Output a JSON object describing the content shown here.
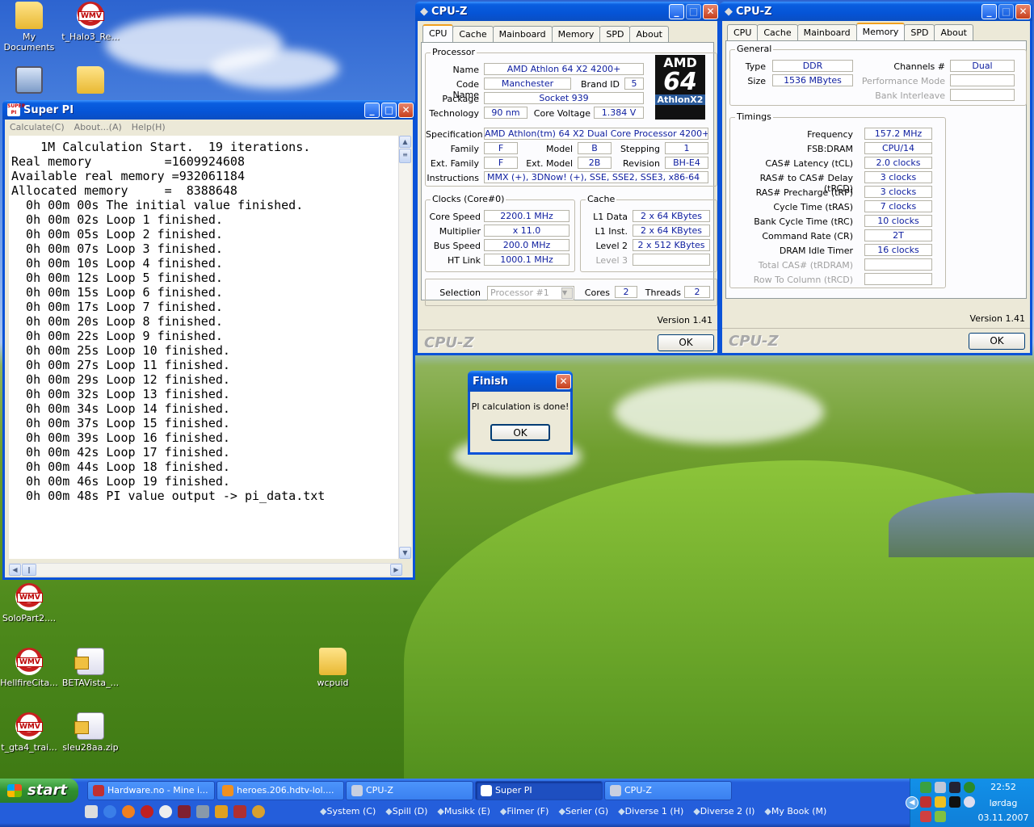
{
  "desktop": {
    "icons": [
      {
        "label": "My Documents",
        "type": "folder"
      },
      {
        "label": "t_Halo3_Re...",
        "type": "wmv"
      },
      {
        "label": "",
        "type": "pc"
      },
      {
        "label": "",
        "type": "folder"
      },
      {
        "label": "SoloPart2....",
        "type": "wmv"
      },
      {
        "label": "HellfireCita...",
        "type": "wmv"
      },
      {
        "label": "BETAVista_...",
        "type": "zip"
      },
      {
        "label": "wcpuid",
        "type": "folder"
      },
      {
        "label": "t_gta4_trai...",
        "type": "wmv"
      },
      {
        "label": "sleu28aa.zip",
        "type": "zip"
      }
    ]
  },
  "superpi": {
    "title": "Super PI",
    "menu": [
      "Calculate(C)",
      "About...(A)",
      "Help(H)"
    ],
    "lines": [
      "    1M Calculation Start.  19 iterations.",
      "Real memory          =1609924608",
      "Available real memory =932061184",
      "Allocated memory     =  8388648",
      "  0h 00m 00s The initial value finished.",
      "  0h 00m 02s Loop 1 finished.",
      "  0h 00m 05s Loop 2 finished.",
      "  0h 00m 07s Loop 3 finished.",
      "  0h 00m 10s Loop 4 finished.",
      "  0h 00m 12s Loop 5 finished.",
      "  0h 00m 15s Loop 6 finished.",
      "  0h 00m 17s Loop 7 finished.",
      "  0h 00m 20s Loop 8 finished.",
      "  0h 00m 22s Loop 9 finished.",
      "  0h 00m 25s Loop 10 finished.",
      "  0h 00m 27s Loop 11 finished.",
      "  0h 00m 29s Loop 12 finished.",
      "  0h 00m 32s Loop 13 finished.",
      "  0h 00m 34s Loop 14 finished.",
      "  0h 00m 37s Loop 15 finished.",
      "  0h 00m 39s Loop 16 finished.",
      "  0h 00m 42s Loop 17 finished.",
      "  0h 00m 44s Loop 18 finished.",
      "  0h 00m 46s Loop 19 finished.",
      "  0h 00m 48s PI value output -> pi_data.txt"
    ]
  },
  "cpuz1": {
    "title": "CPU-Z",
    "tabs": [
      "CPU",
      "Cache",
      "Mainboard",
      "Memory",
      "SPD",
      "About"
    ],
    "processor_label": "Processor",
    "name_label": "Name",
    "name": "AMD Athlon 64 X2 4200+",
    "codename_label": "Code Name",
    "codename": "Manchester",
    "brandid_label": "Brand ID",
    "brandid": "5",
    "package_label": "Package",
    "package": "Socket 939",
    "tech_label": "Technology",
    "tech": "90 nm",
    "voltage_label": "Core Voltage",
    "voltage": "1.384 V",
    "spec_label": "Specification",
    "spec": "AMD Athlon(tm) 64 X2 Dual Core Processor 4200+",
    "family_label": "Family",
    "family": "F",
    "model_label": "Model",
    "model": "B",
    "stepping_label": "Stepping",
    "stepping": "1",
    "extfamily_label": "Ext. Family",
    "extfamily": "F",
    "extmodel_label": "Ext. Model",
    "extmodel": "2B",
    "revision_label": "Revision",
    "revision": "BH-E4",
    "instr_label": "Instructions",
    "instr": "MMX (+), 3DNow! (+), SSE, SSE2, SSE3, x86-64",
    "logo": {
      "amd": "AMD",
      "n": "64",
      "sub": "AthlonX2"
    },
    "clocks_label": "Clocks (Core#0)",
    "corespeed_label": "Core Speed",
    "corespeed": "2200.1 MHz",
    "multiplier_label": "Multiplier",
    "multiplier": "x 11.0",
    "busspeed_label": "Bus Speed",
    "busspeed": "200.0 MHz",
    "htlink_label": "HT Link",
    "htlink": "1000.1 MHz",
    "cache_label": "Cache",
    "l1d_label": "L1 Data",
    "l1d": "2 x 64 KBytes",
    "l1i_label": "L1 Inst.",
    "l1i": "2 x 64 KBytes",
    "l2_label": "Level 2",
    "l2": "2 x 512 KBytes",
    "l3_label": "Level 3",
    "l3": "",
    "selection_label": "Selection",
    "selection": "Processor #1",
    "cores_label": "Cores",
    "cores": "2",
    "threads_label": "Threads",
    "threads": "2",
    "version": "Version 1.41",
    "brand": "CPU-Z",
    "ok": "OK"
  },
  "cpuz2": {
    "title": "CPU-Z",
    "tabs": [
      "CPU",
      "Cache",
      "Mainboard",
      "Memory",
      "SPD",
      "About"
    ],
    "general_label": "General",
    "type_label": "Type",
    "type": "DDR",
    "size_label": "Size",
    "size": "1536 MBytes",
    "channels_label": "Channels #",
    "channels": "Dual",
    "perfmode_label": "Performance Mode",
    "perfmode": "",
    "bankint_label": "Bank Interleave",
    "bankint": "",
    "timings_label": "Timings",
    "timings": [
      {
        "label": "Frequency",
        "value": "157.2 MHz",
        "dim": false
      },
      {
        "label": "FSB:DRAM",
        "value": "CPU/14",
        "dim": false
      },
      {
        "label": "CAS# Latency (tCL)",
        "value": "2.0 clocks",
        "dim": false
      },
      {
        "label": "RAS# to CAS# Delay (tRCD)",
        "value": "3 clocks",
        "dim": false
      },
      {
        "label": "RAS# Precharge (tRP)",
        "value": "3 clocks",
        "dim": false
      },
      {
        "label": "Cycle Time (tRAS)",
        "value": "7 clocks",
        "dim": false
      },
      {
        "label": "Bank Cycle Time (tRC)",
        "value": "10 clocks",
        "dim": false
      },
      {
        "label": "Command Rate (CR)",
        "value": "2T",
        "dim": false
      },
      {
        "label": "DRAM Idle Timer",
        "value": "16 clocks",
        "dim": false
      },
      {
        "label": "Total CAS# (tRDRAM)",
        "value": "",
        "dim": true
      },
      {
        "label": "Row To Column (tRCD)",
        "value": "",
        "dim": true
      }
    ],
    "version": "Version 1.41",
    "brand": "CPU-Z",
    "ok": "OK"
  },
  "dialog": {
    "title": "Finish",
    "message": "PI calculation is done!",
    "ok": "OK"
  },
  "taskbar": {
    "start": "start",
    "tasks": [
      {
        "label": "Hardware.no - Mine i...",
        "active": false
      },
      {
        "label": "heroes.206.hdtv-lol....",
        "active": false
      },
      {
        "label": "CPU-Z",
        "active": false
      },
      {
        "label": "Super PI",
        "active": true
      },
      {
        "label": "CPU-Z",
        "active": false
      }
    ],
    "toolbar": [
      "System (C)",
      "Spill (D)",
      "Musikk (E)",
      "Filmer (F)",
      "Serier (G)",
      "Diverse 1 (H)",
      "Diverse 2 (I)",
      "My Book (M)"
    ],
    "clock": {
      "time": "22:52",
      "day": "lørdag",
      "date": "03.11.2007"
    }
  },
  "colors": {
    "xp_blue": "#0b53d8",
    "value_text": "#1020a0",
    "start_green": "#2f8f2f"
  }
}
